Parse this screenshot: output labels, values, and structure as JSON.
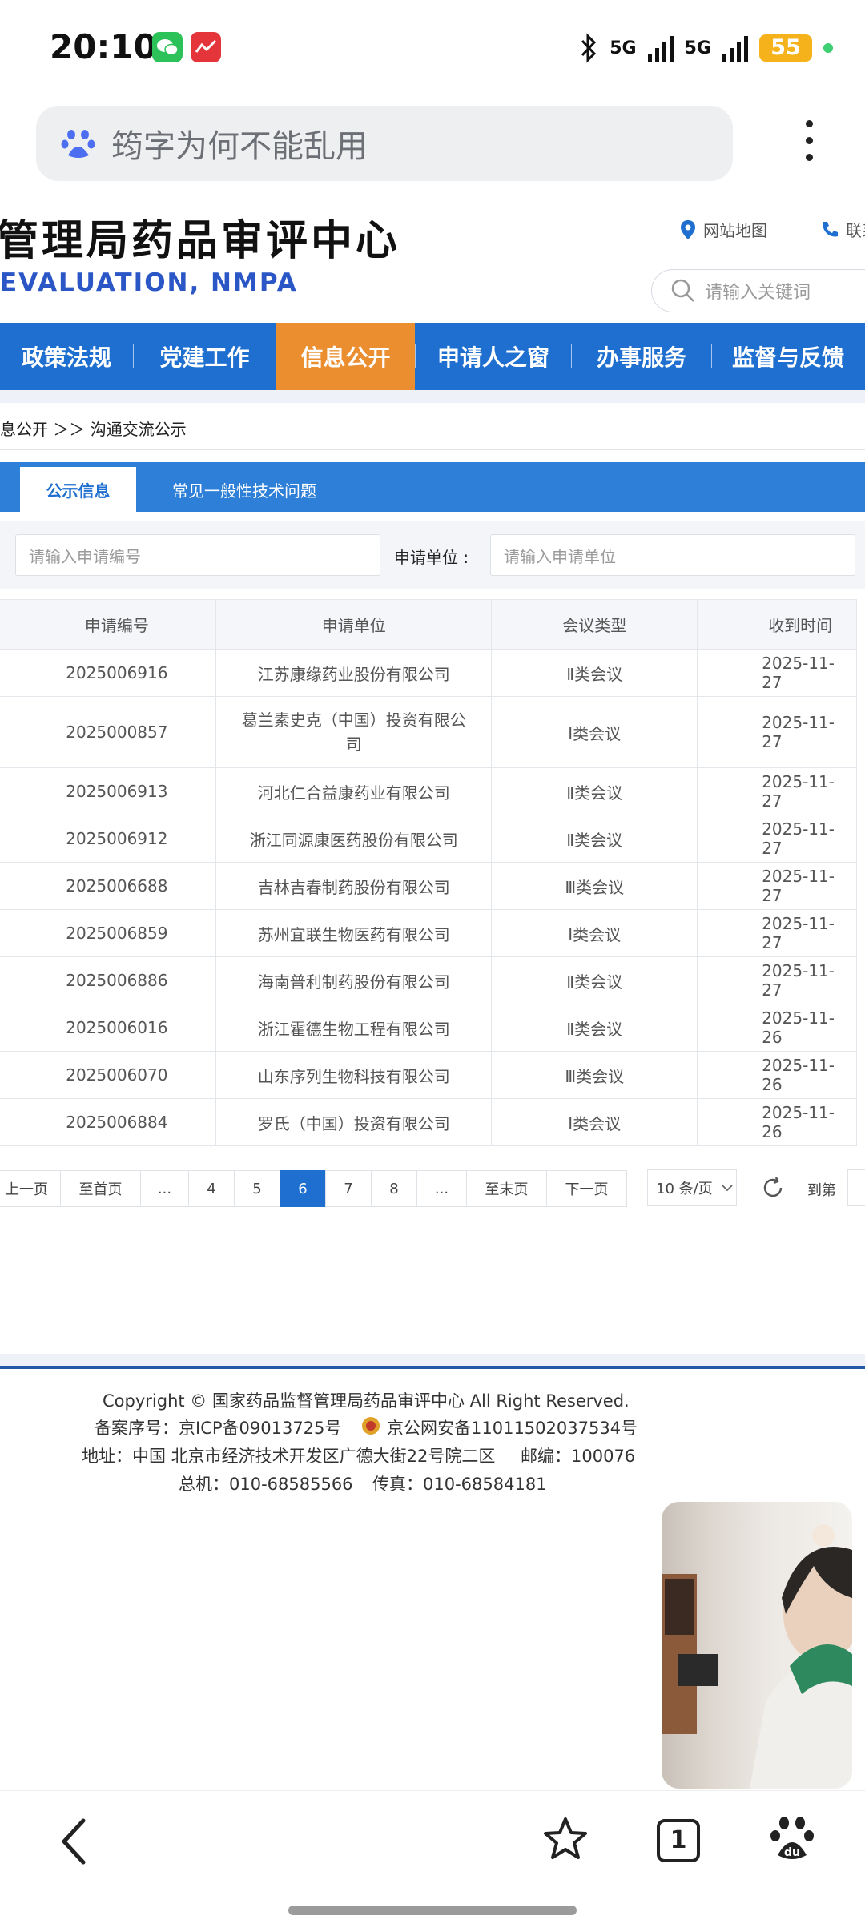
{
  "status_bar": {
    "time": "20:10",
    "signal1": "5G",
    "signal2": "5G",
    "battery": "55",
    "icons": [
      "wechat-icon",
      "app-icon",
      "bluetooth-icon"
    ]
  },
  "browser": {
    "address_text": "筠字为何不能乱用",
    "menu_icon": "more-vertical-icon"
  },
  "site": {
    "title": "管理局药品审评中心",
    "subtitle": "EVALUATION, NMPA",
    "sitemap": "网站地图",
    "contact": "联系",
    "search_placeholder": "请输入关键词"
  },
  "nav": {
    "items": [
      "政策法规",
      "党建工作",
      "信息公开",
      "申请人之窗",
      "办事服务",
      "监督与反馈"
    ],
    "active_index": 2,
    "active_color": "#ea8e2f"
  },
  "breadcrumb": {
    "text": "息公开 ＞＞ 沟通交流公示"
  },
  "tabs": {
    "active": "公示信息",
    "other": "常见一般性技术问题"
  },
  "filters": {
    "code_placeholder": "请输入申请编号",
    "unit_label": "申请单位 :",
    "unit_placeholder": "请输入申请单位"
  },
  "table": {
    "headers": [
      "申请编号",
      "申请单位",
      "会议类型",
      "收到时间"
    ],
    "rows": [
      [
        "2025006916",
        "江苏康缘药业股份有限公司",
        "Ⅱ类会议",
        "2025-11-27"
      ],
      [
        "2025000857",
        "葛兰素史克（中国）投资有限公司",
        "Ⅰ类会议",
        "2025-11-27"
      ],
      [
        "2025006913",
        "河北仁合益康药业有限公司",
        "Ⅱ类会议",
        "2025-11-27"
      ],
      [
        "2025006912",
        "浙江同源康医药股份有限公司",
        "Ⅱ类会议",
        "2025-11-27"
      ],
      [
        "2025006688",
        "吉林吉春制药股份有限公司",
        "Ⅲ类会议",
        "2025-11-27"
      ],
      [
        "2025006859",
        "苏州宜联生物医药有限公司",
        "Ⅰ类会议",
        "2025-11-27"
      ],
      [
        "2025006886",
        "海南普利制药股份有限公司",
        "Ⅱ类会议",
        "2025-11-27"
      ],
      [
        "2025006016",
        "浙江霍德生物工程有限公司",
        "Ⅱ类会议",
        "2025-11-26"
      ],
      [
        "2025006070",
        "山东序列生物科技有限公司",
        "Ⅲ类会议",
        "2025-11-26"
      ],
      [
        "2025006884",
        "罗氏（中国）投资有限公司",
        "Ⅰ类会议",
        "2025-11-26"
      ]
    ]
  },
  "pagination": {
    "prev": "上一页",
    "first": "至首页",
    "ellipsis": "...",
    "pages": [
      "4",
      "5",
      "6",
      "7",
      "8"
    ],
    "current": "6",
    "last": "至末页",
    "next": "下一页",
    "per_page": "10 条/页",
    "goto": "到第"
  },
  "footer": {
    "copyright": "Copyright © 国家药品监督管理局药品审评中心   All Right Reserved.",
    "icp": "备案序号：京ICP备09013725号",
    "police": "京公网安备11011502037534号",
    "address": "地址：中国 北京市经济技术开发区广德大街22号院二区",
    "postcode": "邮编：100076",
    "phone": "总机：010-68585566",
    "fax": "传真：010-68584181"
  },
  "bottom_nav": {
    "tab_count": "1",
    "icons": [
      "back-icon",
      "star-icon",
      "tabs-icon",
      "baidu-icon"
    ]
  }
}
